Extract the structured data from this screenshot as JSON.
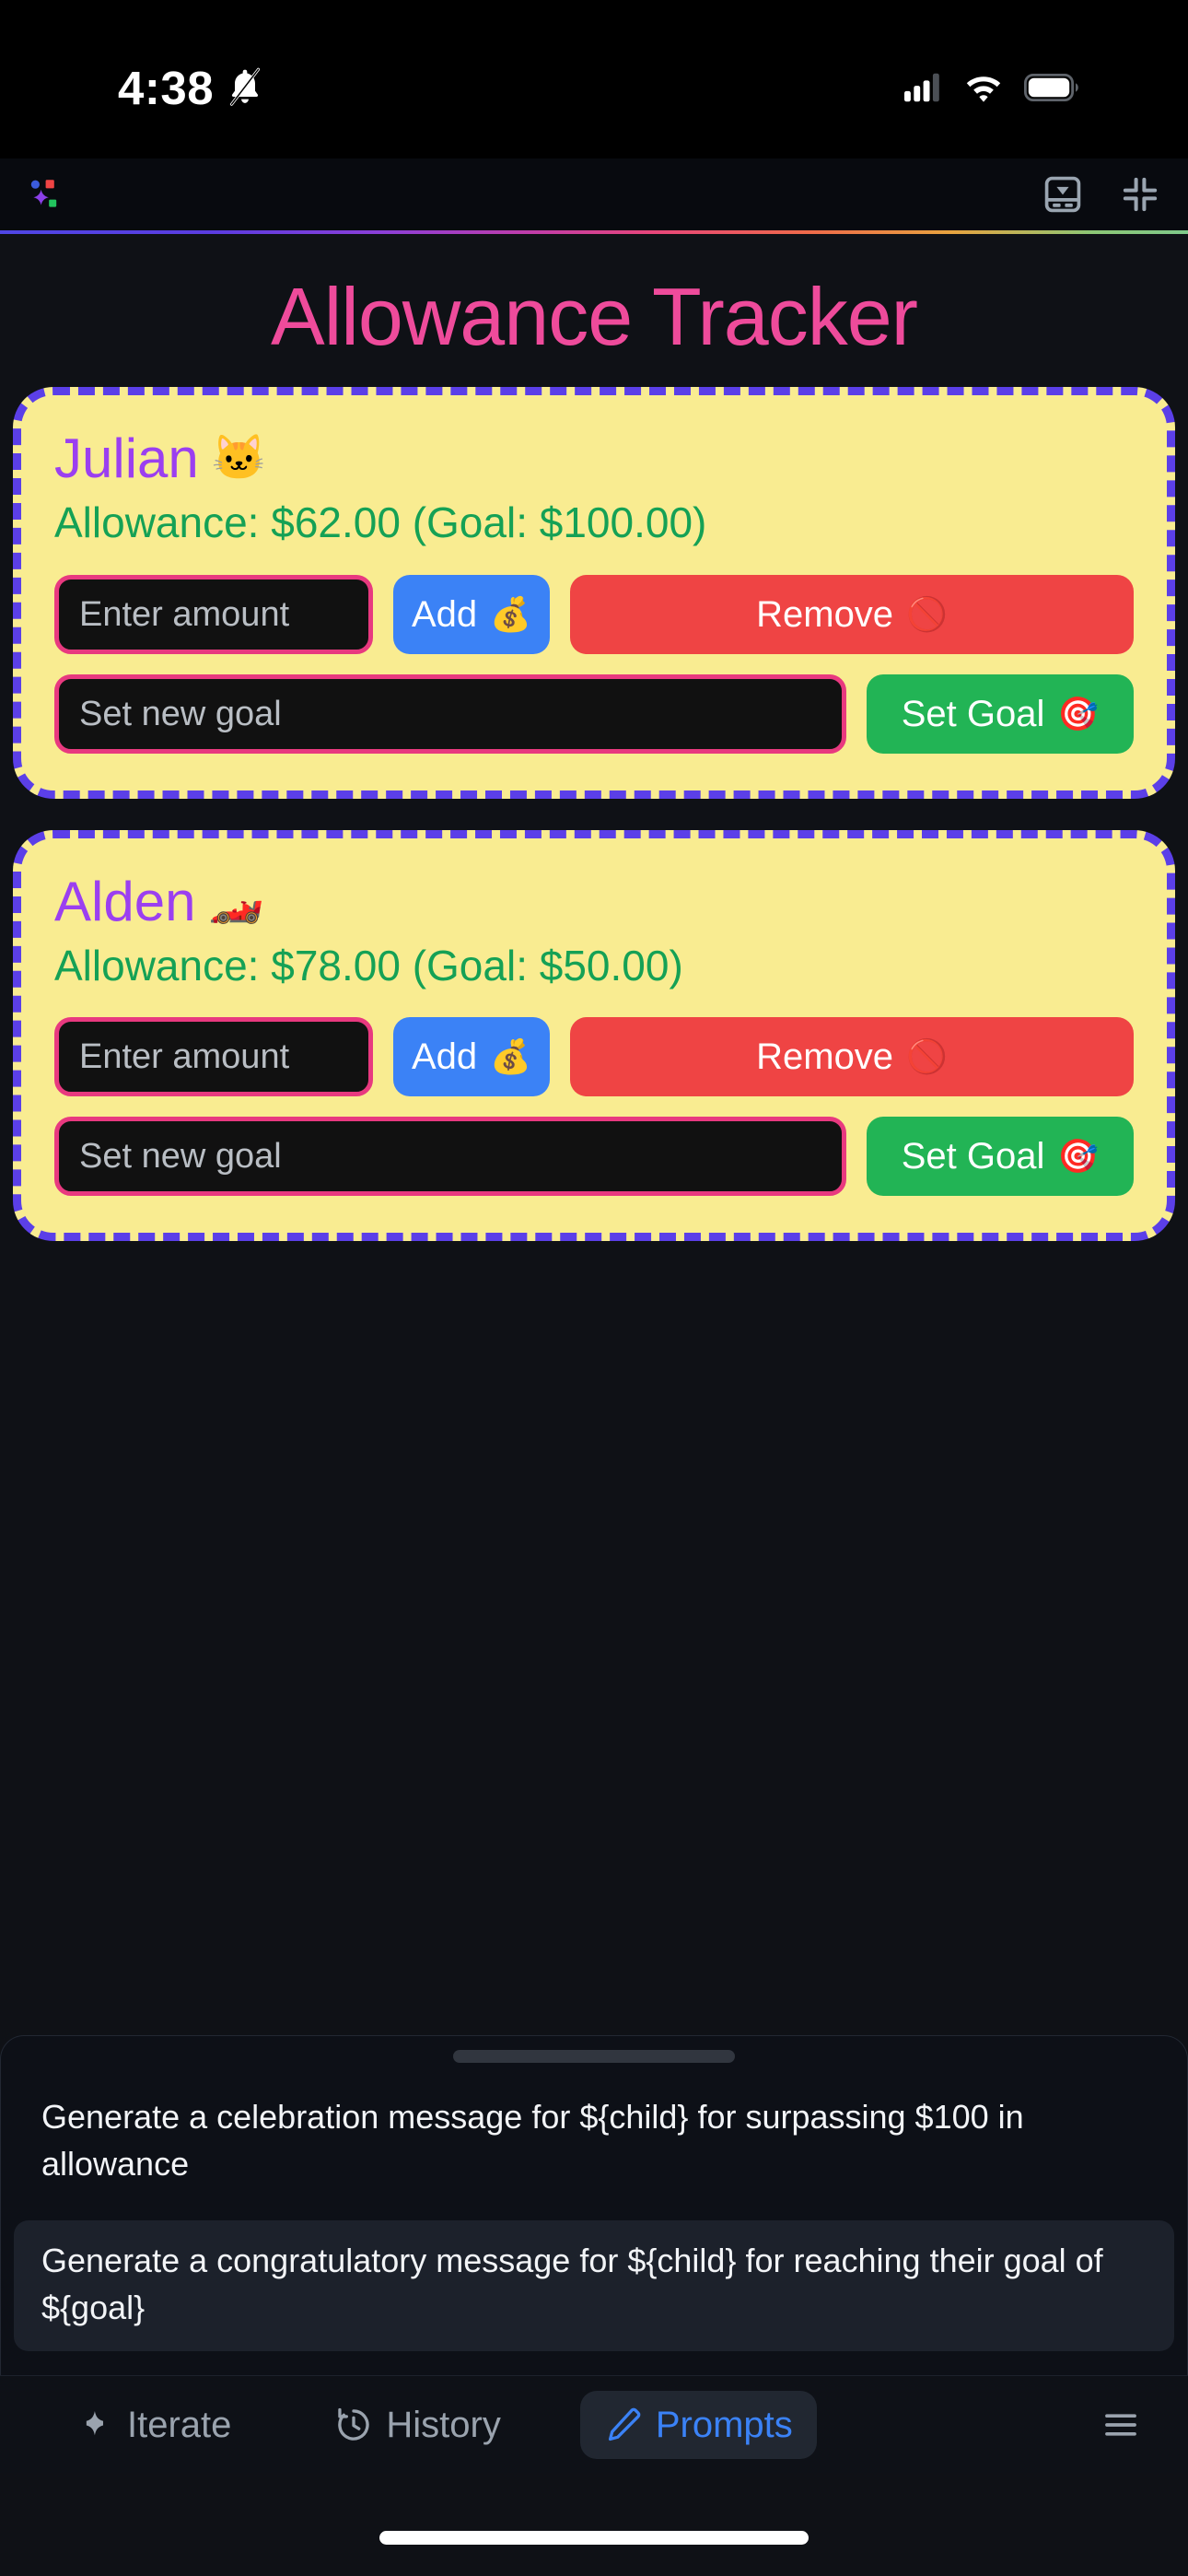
{
  "status_bar": {
    "time": "4:38",
    "icons": {
      "notifications": "bell-slash-icon",
      "signal": "cellular-signal-icon",
      "wifi": "wifi-icon",
      "battery": "battery-icon"
    }
  },
  "app_toolbar": {
    "logo": "sparkle-logo-icon",
    "actions": [
      {
        "name": "dock-panel-icon"
      },
      {
        "name": "collapse-fullscreen-icon"
      }
    ]
  },
  "page": {
    "title": "Allowance Tracker",
    "title_color": "#ee4b9b",
    "card_bg": "#f9ec91",
    "card_border_color": "#5b3fe8",
    "name_color": "#9b3ff0",
    "allowance_color": "#15a155"
  },
  "children": [
    {
      "name": "Julian",
      "emoji": "🐱",
      "allowance_line": "Allowance: $62.00 (Goal: $100.00)",
      "balance": "$62.00",
      "goal": "$100.00",
      "amount_placeholder": "Enter amount",
      "goal_placeholder": "Set new goal",
      "add_label": "Add",
      "add_emoji": "💰",
      "remove_label": "Remove",
      "remove_emoji": "🚫",
      "setgoal_label": "Set Goal",
      "setgoal_emoji": "🎯"
    },
    {
      "name": "Alden",
      "emoji": "🏎️",
      "allowance_line": "Allowance: $78.00 (Goal: $50.00)",
      "balance": "$78.00",
      "goal": "$50.00",
      "amount_placeholder": "Enter amount",
      "goal_placeholder": "Set new goal",
      "add_label": "Add",
      "add_emoji": "💰",
      "remove_label": "Remove",
      "remove_emoji": "🚫",
      "setgoal_label": "Set Goal",
      "setgoal_emoji": "🎯"
    }
  ],
  "bottom_sheet": {
    "prompts": [
      {
        "text": "Generate a celebration message for ${child} for surpassing $100 in allowance",
        "highlighted": false
      },
      {
        "text": "Generate a congratulatory message for ${child} for reaching their goal of ${goal}",
        "highlighted": true
      }
    ]
  },
  "bottom_nav": {
    "items": [
      {
        "label": "Iterate",
        "icon": "sparkle-icon",
        "active": false
      },
      {
        "label": "History",
        "icon": "clock-rewind-icon",
        "active": false
      },
      {
        "label": "Prompts",
        "icon": "pencil-icon",
        "active": true
      }
    ],
    "menu_icon": "hamburger-menu-icon",
    "active_color": "#3b82f6",
    "inactive_color": "#9aa3ae"
  }
}
